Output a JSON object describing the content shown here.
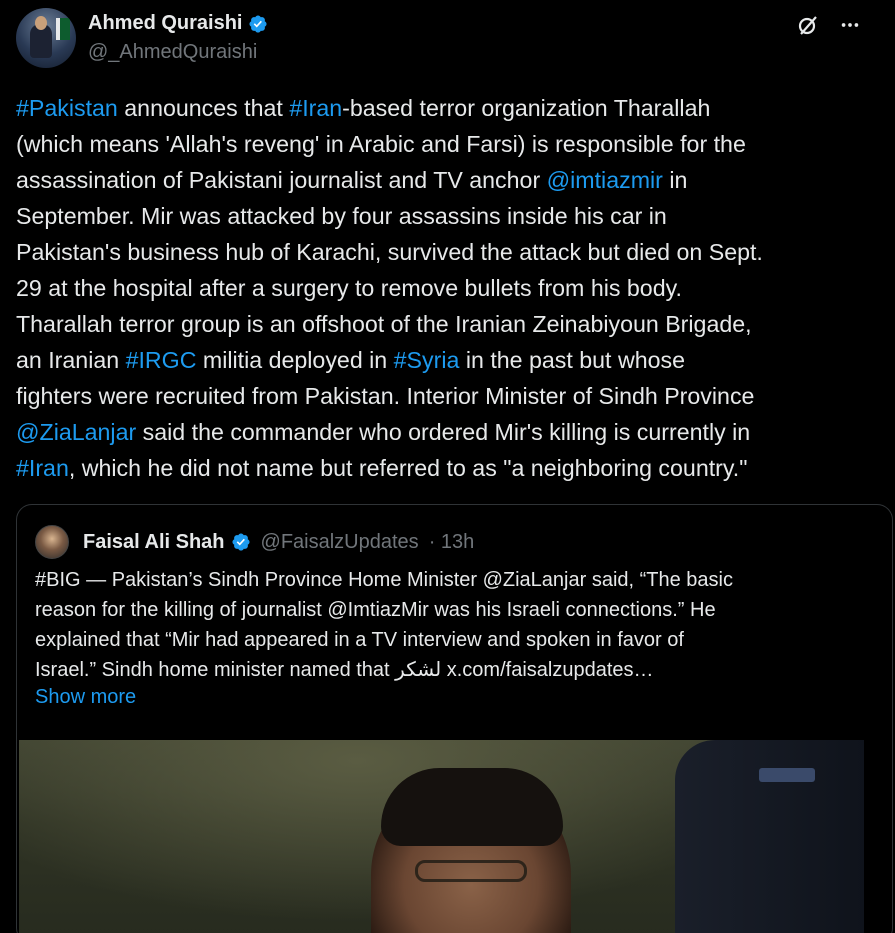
{
  "tweet": {
    "author": {
      "name": "Ahmed Quraishi",
      "handle": "@_AhmedQuraishi",
      "verified": true
    },
    "header_icons": [
      "grok-icon",
      "more-icon"
    ],
    "lines": [
      [
        {
          "t": "#Pakistan",
          "link": true
        },
        {
          "t": " announces that "
        },
        {
          "t": "#Iran",
          "link": true
        },
        {
          "t": "-based terror organization Tharallah"
        }
      ],
      [
        {
          "t": "(which means 'Allah's reveng' in Arabic and Farsi) is responsible for the"
        }
      ],
      [
        {
          "t": "assassination of Pakistani journalist and TV anchor "
        },
        {
          "t": "@imtiazmir",
          "link": true
        },
        {
          "t": " in"
        }
      ],
      [
        {
          "t": "September. Mir was attacked by four assassins inside his car in"
        }
      ],
      [
        {
          "t": "Pakistan's business hub of Karachi, survived the attack but died on Sept."
        }
      ],
      [
        {
          "t": "29 at the hospital after a surgery to remove bullets from his body."
        }
      ],
      [
        {
          "t": "Tharallah terror group is an offshoot of the Iranian Zeinabiyoun Brigade,"
        }
      ],
      [
        {
          "t": "an Iranian "
        },
        {
          "t": "#IRGC",
          "link": true
        },
        {
          "t": " militia deployed in "
        },
        {
          "t": "#Syria",
          "link": true
        },
        {
          "t": " in the past but whose"
        }
      ],
      [
        {
          "t": "fighters were recruited from Pakistan. Interior Minister of Sindh Province"
        }
      ],
      [
        {
          "t": "@ZiaLanjar",
          "link": true
        },
        {
          "t": " said the commander who ordered Mir's killing is currently in"
        }
      ],
      [
        {
          "t": "#Iran",
          "link": true
        },
        {
          "t": ", which he did not name but referred to as \"a neighboring country.\""
        }
      ]
    ]
  },
  "quote": {
    "author": {
      "name": "Faisal Ali Shah",
      "handle": "@FaisalzUpdates",
      "time": "· 13h",
      "verified": true
    },
    "lines": [
      "#BIG — Pakistan’s Sindh Province Home Minister @ZiaLanjar said, “The basic",
      "reason for the killing of journalist @ImtiazMir was his Israeli connections.” He",
      "explained that “Mir had appeared in a TV interview and spoken in favor of",
      "Israel.” Sindh home minister named that لشکر  x.com/faisalzupdates…"
    ],
    "show_more": "Show more",
    "media_alt": "video-still"
  },
  "colors": {
    "background": "#000000",
    "text": "#e7e9ea",
    "muted": "#71767b",
    "link": "#1d9bf0",
    "border": "#2f3336"
  }
}
